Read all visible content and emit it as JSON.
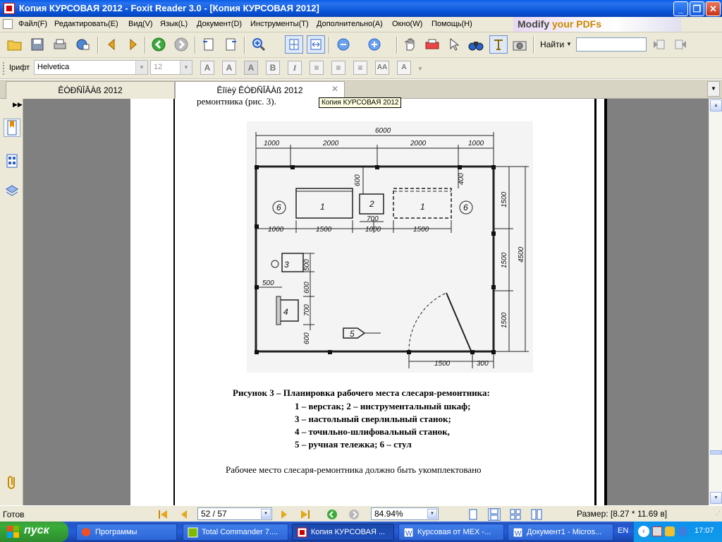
{
  "window": {
    "title": "Копия КУРСОВАЯ 2012 - Foxit Reader 3.0 - [Копия КУРСОВАЯ 2012]"
  },
  "menu": [
    "Файл(F)",
    "Редактировать(E)",
    "Вид(V)",
    "Язык(L)",
    "Документ(D)",
    "Инструменты(T)",
    "Дополнительно(A)",
    "Окно(W)",
    "Помощь(H)"
  ],
  "banner": {
    "part1": "Modify ",
    "part2": "your PDFs"
  },
  "toolbar": {
    "find_label": "Найти",
    "find_value": ""
  },
  "format_bar": {
    "font_label": "Ірифт",
    "font_value": "Helvetica",
    "size_value": "12"
  },
  "tabs": [
    {
      "label": "ÊÓÐÑÎÂÀß 2012"
    },
    {
      "label": "Êîïèÿ ÊÓÐÑÎÂÀß 2012"
    }
  ],
  "tooltip": "Копия КУРСОВАЯ 2012",
  "document": {
    "top_text": "ремонтника (рис. 3).",
    "figure": {
      "dims": {
        "total": "6000",
        "seg1": "1000",
        "seg2": "2000",
        "seg3": "2000",
        "seg4": "1000",
        "h600": "600",
        "h400": "400",
        "w1000a": "1000",
        "w1500a": "1500",
        "w1000b": "1000",
        "w1500b": "1500",
        "w700": "700",
        "r1500a": "1500",
        "r1500b": "1500",
        "r1500c": "1500",
        "r4500": "4500",
        "v500": "500",
        "v600a": "600",
        "v700": "700",
        "v600b": "600",
        "w500": "500",
        "b1500": "1500",
        "b300": "300"
      },
      "labels": {
        "bench1": "1",
        "bench1b": "1",
        "cabinet": "2",
        "drill": "3",
        "grinder": "4",
        "cart": "5",
        "chair": "6",
        "chair2": "6"
      }
    },
    "caption_lines": [
      "Рисунок 3 – Планировка рабочего места слесаря-ремонтника:",
      "1 – верстак; 2 – инструментальный шкаф;",
      "3 – настольный сверлильный станок;",
      "4 – точильно-шлифовальный станок,",
      "5 – ручная тележка; 6 – стул"
    ],
    "bottom_text": "Рабочее     место     слесаря-ремонтника     должно     быть     укомплектовано"
  },
  "status": {
    "left": "Готов",
    "page": "52 / 57",
    "zoom": "84.94%",
    "size": "Размер: [8.27 * 11.69 в]"
  },
  "taskbar": {
    "start": "пуск",
    "tasks": [
      "Программы",
      "Total Commander 7....",
      "Копия КУРСОВАЯ ...",
      "Курсовая от МЕХ -...",
      "Документ1 - Micros..."
    ],
    "lang": "EN",
    "clock": "17:07"
  }
}
